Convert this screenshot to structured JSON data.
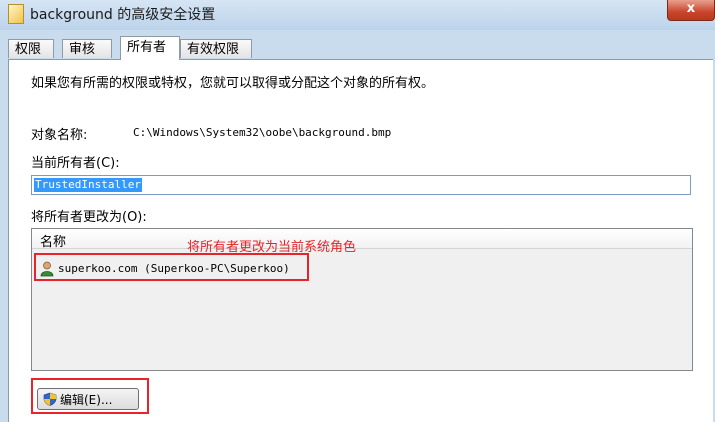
{
  "window": {
    "title": "background 的高级安全设置",
    "close_label": "x"
  },
  "tabs": [
    {
      "label": "权限"
    },
    {
      "label": "审核"
    },
    {
      "label": "所有者",
      "active": true
    },
    {
      "label": "有效权限"
    }
  ],
  "panel": {
    "info_text": "如果您有所需的权限或特权，您就可以取得或分配这个对象的所有权。",
    "object_name_label": "对象名称:",
    "object_name_value": "C:\\Windows\\System32\\oobe\\background.bmp",
    "current_owner_label": "当前所有者(C):",
    "current_owner_value": "TrustedInstaller",
    "change_owner_label": "将所有者更改为(O):",
    "list": {
      "column_name": "名称",
      "items": [
        {
          "label": "superkoo.com (Superkoo-PC\\Superkoo)",
          "icon": "user-icon"
        }
      ]
    },
    "annotation": "将所有者更改为当前系统角色",
    "edit_button_label": "编辑(E)..."
  },
  "colors": {
    "annotation": "#e8232a",
    "selection": "#3399ff",
    "titlebar": "#c9dcee"
  }
}
